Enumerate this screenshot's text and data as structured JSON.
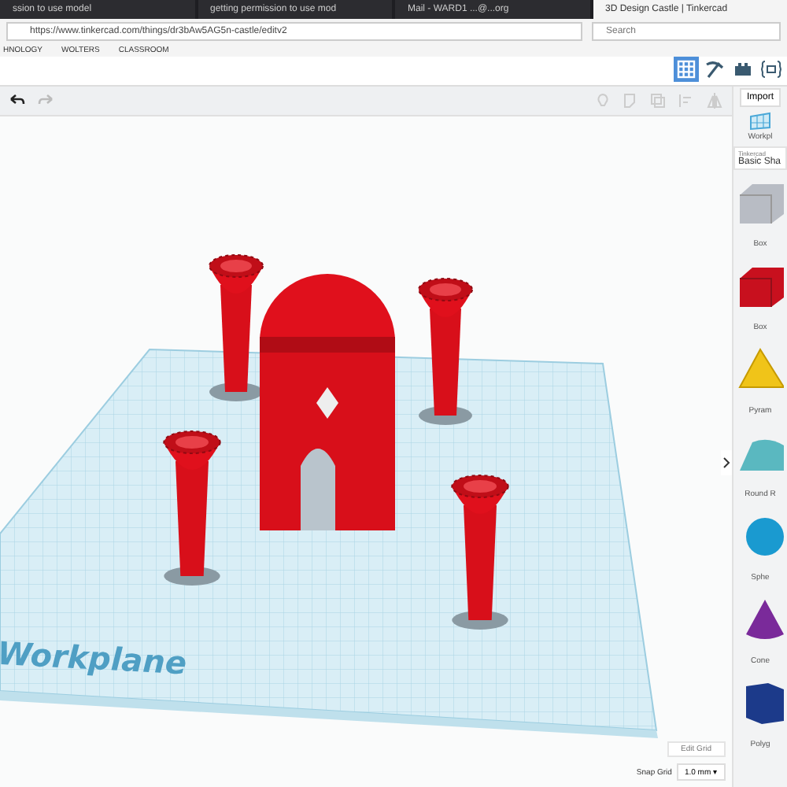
{
  "browser": {
    "tabs": [
      {
        "title": "ssion to use model",
        "selected": false
      },
      {
        "title": "getting permission to use mod",
        "selected": false
      },
      {
        "title": "Mail - WARD1 ...@...org",
        "selected": false
      },
      {
        "title": "3D Design Castle | Tinkercad",
        "selected": true
      }
    ],
    "url": "https://www.tinkercad.com/things/dr3bAw5AG5n-castle/editv2",
    "search_placeholder": "Search",
    "bookmarks": [
      "HNOLOGY",
      "WOLTERS",
      "CLASSROOM"
    ]
  },
  "app_header": {
    "views": [
      {
        "kind": "grid",
        "selected": true
      },
      {
        "kind": "pickaxe",
        "selected": false
      },
      {
        "kind": "brick",
        "selected": false
      },
      {
        "kind": "code",
        "selected": false
      }
    ]
  },
  "toolbar": {
    "import_label": "Import"
  },
  "canvas": {
    "workplane_label": "Workplane",
    "edit_grid": "Edit Grid",
    "snap_grid_label": "Snap Grid",
    "snap_grid_value": "1.0 mm ▾"
  },
  "panel": {
    "workplane_label": "Workpl",
    "library_caption": "Tinkercad",
    "library_name": "Basic Sha",
    "shapes": [
      {
        "kind": "box-hole",
        "label": "Box"
      },
      {
        "kind": "box",
        "label": "Box"
      },
      {
        "kind": "pyramid",
        "label": "Pyram"
      },
      {
        "kind": "roundroof",
        "label": "Round R"
      },
      {
        "kind": "sphere",
        "label": "Sphe"
      },
      {
        "kind": "cone",
        "label": "Cone"
      },
      {
        "kind": "polygon",
        "label": "Polyg"
      }
    ]
  }
}
